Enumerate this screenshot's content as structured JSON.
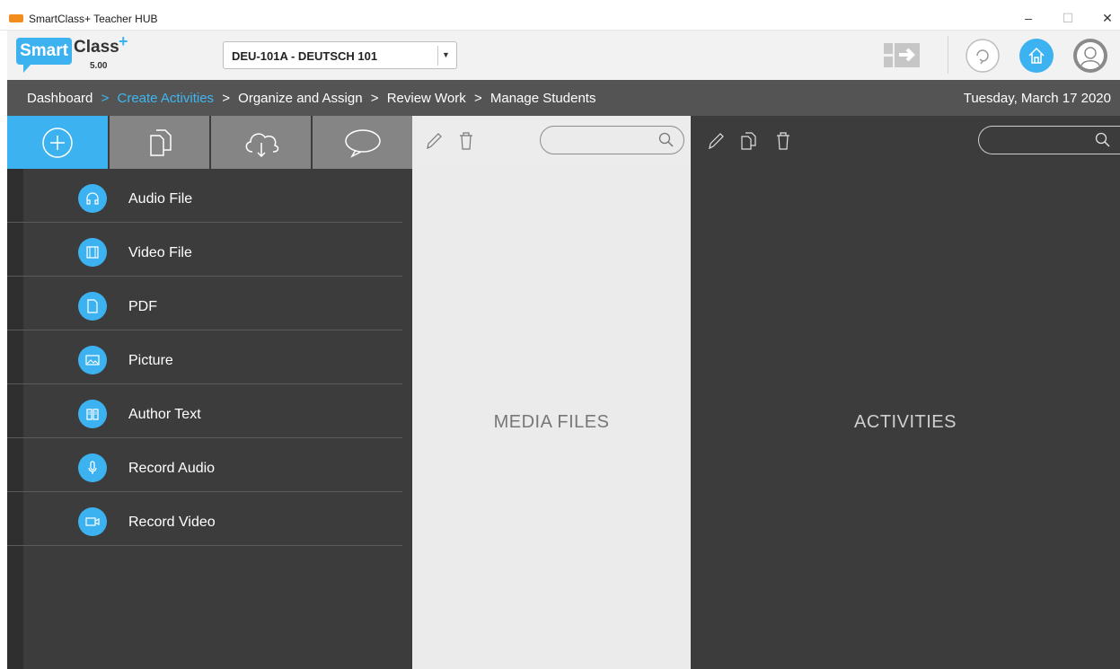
{
  "window": {
    "title": "SmartClass+ Teacher HUB",
    "minimize": "–",
    "maximize": "☐",
    "close": "✕"
  },
  "header": {
    "logo_left": "Smart",
    "logo_right": "Class",
    "logo_plus": "+",
    "version": "5.00",
    "course_selected": "DEU-101A - DEUTSCH 101",
    "dropdown_arrow": "▼",
    "icons": [
      "exit-session-icon",
      "sync-icon",
      "home-icon",
      "user-profile-icon"
    ],
    "accent_color": "#3db2f0"
  },
  "breadcrumb": {
    "items": [
      "Dashboard",
      "Create Activities",
      "Organize and Assign",
      "Review Work",
      "Manage Students"
    ],
    "separator": ">",
    "active_index": 1,
    "date": "Tuesday, March 17 2020"
  },
  "left_panel": {
    "tabs": [
      "add-icon",
      "copy-document-icon",
      "cloud-download-icon",
      "speech-bubble-icon"
    ],
    "active_tab": 0,
    "menu": [
      {
        "label": "Audio File",
        "icon": "headphones-icon"
      },
      {
        "label": "Video File",
        "icon": "film-icon"
      },
      {
        "label": "PDF",
        "icon": "document-icon"
      },
      {
        "label": "Picture",
        "icon": "image-icon"
      },
      {
        "label": "Author Text",
        "icon": "book-icon"
      },
      {
        "label": "Record Audio",
        "icon": "microphone-icon"
      },
      {
        "label": "Record Video",
        "icon": "video-camera-icon"
      }
    ]
  },
  "media_panel": {
    "caption": "MEDIA FILES",
    "search_placeholder": ""
  },
  "activities_panel": {
    "caption": "ACTIVITIES",
    "search_placeholder": ""
  }
}
